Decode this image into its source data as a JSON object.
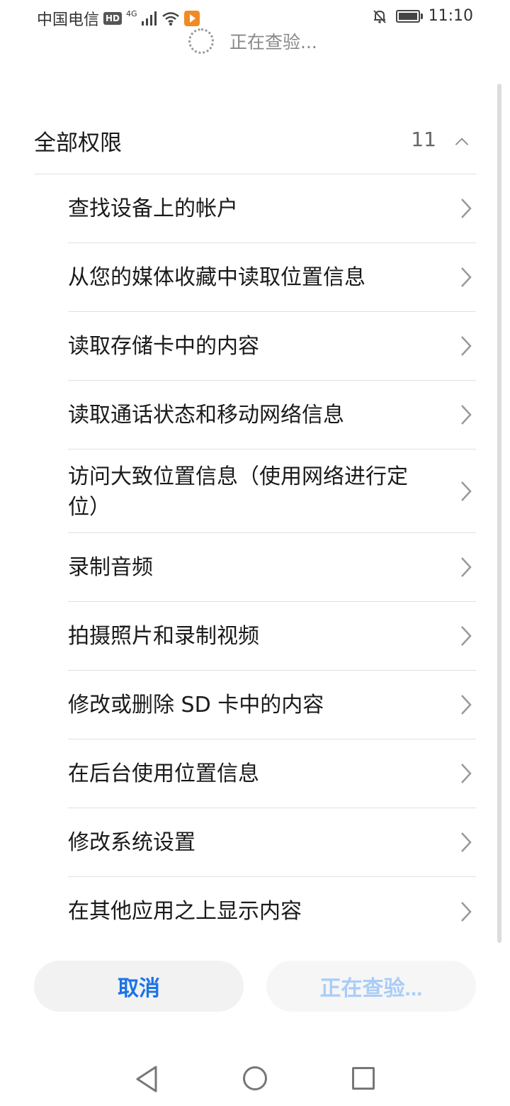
{
  "status_bar": {
    "carrier": "中国电信",
    "hd_badge": "HD",
    "network": "4G",
    "time": "11:10",
    "icons": [
      "signal-icon",
      "wifi-icon",
      "app-notification-icon",
      "mute-bell-icon",
      "battery-icon"
    ]
  },
  "top_status": {
    "text": "正在查验..."
  },
  "section": {
    "title": "全部权限",
    "count": "11"
  },
  "permissions": [
    "查找设备上的帐户",
    "从您的媒体收藏中读取位置信息",
    "读取存储卡中的内容",
    "读取通话状态和移动网络信息",
    "访问大致位置信息（使用网络进行定位）",
    "录制音频",
    "拍摄照片和录制视频",
    "修改或删除 SD 卡中的内容",
    "在后台使用位置信息",
    "修改系统设置",
    "在其他应用之上显示内容"
  ],
  "buttons": {
    "cancel": "取消",
    "verify": "正在查验..."
  },
  "colors": {
    "accent": "#1a73e8",
    "accent_disabled": "#a9cdf7",
    "button_bg": "#f2f2f2",
    "divider": "#e0e0e0"
  },
  "nav_icons": [
    "back-icon",
    "home-icon",
    "recent-apps-icon"
  ]
}
